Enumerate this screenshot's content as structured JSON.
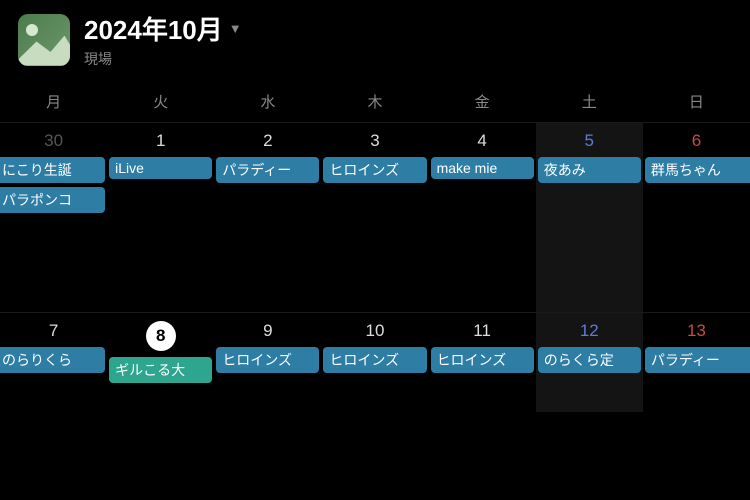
{
  "header": {
    "title": "2024年10月",
    "subtitle": "現場"
  },
  "weekdays": [
    "月",
    "火",
    "水",
    "木",
    "金",
    "土",
    "日"
  ],
  "rows": [
    {
      "cells": [
        {
          "num": "30",
          "dim": true,
          "events": [
            {
              "label": "にこり生誕",
              "edge": "left"
            },
            {
              "label": "パラポンコ",
              "edge": "left"
            }
          ]
        },
        {
          "num": "1",
          "events": [
            {
              "label": "iLive"
            }
          ]
        },
        {
          "num": "2",
          "events": [
            {
              "label": "パラディー"
            }
          ]
        },
        {
          "num": "3",
          "events": [
            {
              "label": "ヒロインズ"
            }
          ]
        },
        {
          "num": "4",
          "events": [
            {
              "label": "make mie"
            }
          ]
        },
        {
          "num": "5",
          "sat": true,
          "weekendCol": true,
          "events": [
            {
              "label": "夜あみ"
            }
          ]
        },
        {
          "num": "6",
          "sun": true,
          "events": [
            {
              "label": "群馬ちゃん",
              "edge": "right"
            }
          ]
        }
      ]
    },
    {
      "short": true,
      "cells": [
        {
          "num": "7",
          "events": [
            {
              "label": "のらりくら",
              "edge": "left"
            }
          ]
        },
        {
          "num": "8",
          "today": true,
          "events": [
            {
              "label": "ギルこる大",
              "color": "teal"
            }
          ]
        },
        {
          "num": "9",
          "events": [
            {
              "label": "ヒロインズ"
            }
          ]
        },
        {
          "num": "10",
          "events": [
            {
              "label": "ヒロインズ"
            }
          ]
        },
        {
          "num": "11",
          "events": [
            {
              "label": "ヒロインズ"
            }
          ]
        },
        {
          "num": "12",
          "sat": true,
          "weekendCol": true,
          "events": [
            {
              "label": "のらくら定"
            }
          ]
        },
        {
          "num": "13",
          "sun": true,
          "events": [
            {
              "label": "パラディー",
              "edge": "right"
            }
          ]
        }
      ]
    }
  ]
}
